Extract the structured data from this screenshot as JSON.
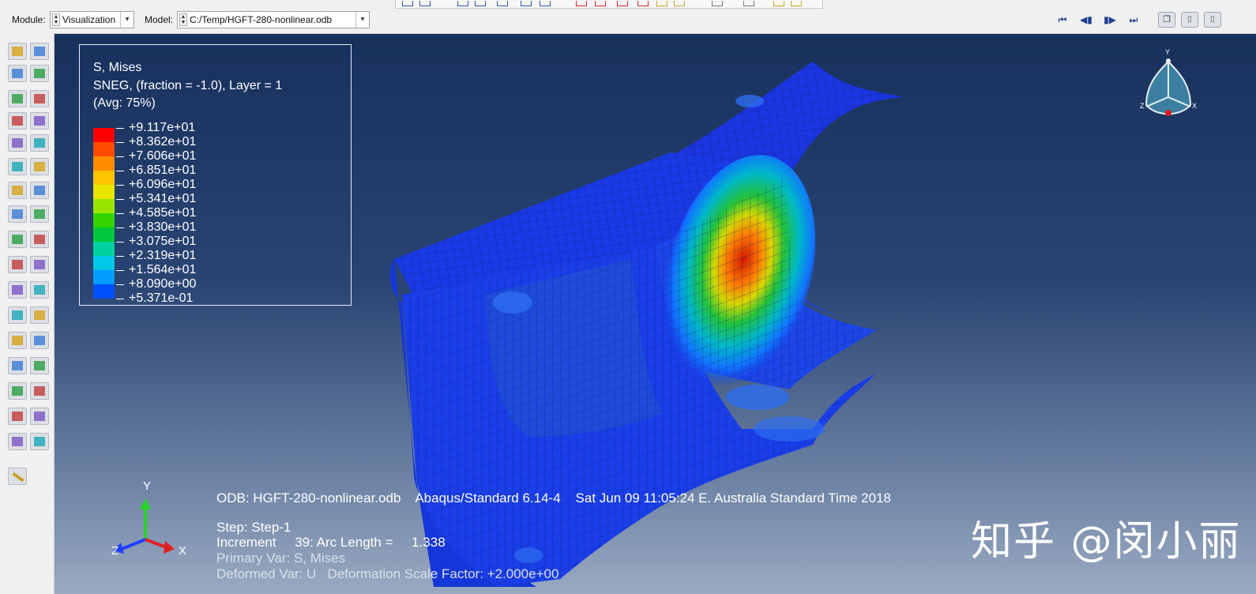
{
  "header": {
    "module_label": "Module:",
    "module_value": "Visualization",
    "model_label": "Model:",
    "model_value": "C:/Temp/HGFT-280-nonlinear.odb"
  },
  "animation_controls": [
    {
      "name": "first-frame-button",
      "icon": "skip-first"
    },
    {
      "name": "previous-frame-button",
      "icon": "step-back"
    },
    {
      "name": "next-frame-button",
      "icon": "step-forward"
    },
    {
      "name": "last-frame-button",
      "icon": "skip-last"
    }
  ],
  "camera_controls": [
    {
      "name": "copy-view-button",
      "icon": "copy"
    },
    {
      "name": "snapshot-button",
      "icon": "camera"
    },
    {
      "name": "camera-button",
      "icon": "camera"
    }
  ],
  "legend": {
    "title": "S, Mises",
    "subtitle": "SNEG, (fraction = -1.0), Layer = 1",
    "averaging": "(Avg: 75%)",
    "values": [
      "+9.117e+01",
      "+8.362e+01",
      "+7.606e+01",
      "+6.851e+01",
      "+6.096e+01",
      "+5.341e+01",
      "+4.585e+01",
      "+3.830e+01",
      "+3.075e+01",
      "+2.319e+01",
      "+1.564e+01",
      "+8.090e+00",
      "+5.371e-01"
    ],
    "colors": [
      "#ff0000",
      "#ff4a00",
      "#ff8c00",
      "#ffc400",
      "#e6e600",
      "#9be600",
      "#33d400",
      "#00c83c",
      "#00d29e",
      "#00c8e6",
      "#009cff",
      "#0050ff",
      "#0000ff"
    ]
  },
  "info": {
    "odb_line": "ODB: HGFT-280-nonlinear.odb    Abaqus/Standard 6.14-4    Sat Jun 09 11:05:24 E. Australia Standard Time 2018",
    "step_line": "Step: Step-1",
    "increment_line": "Increment     39: Arc Length =     1.338",
    "primary_var_line": "Primary Var: S, Mises",
    "deformed_var_line": "Deformed Var: U   Deformation Scale Factor: +2.000e+00"
  },
  "triad": {
    "y": "Y",
    "z": "Z",
    "x": "X"
  },
  "watermark": "知乎 @闵小丽"
}
